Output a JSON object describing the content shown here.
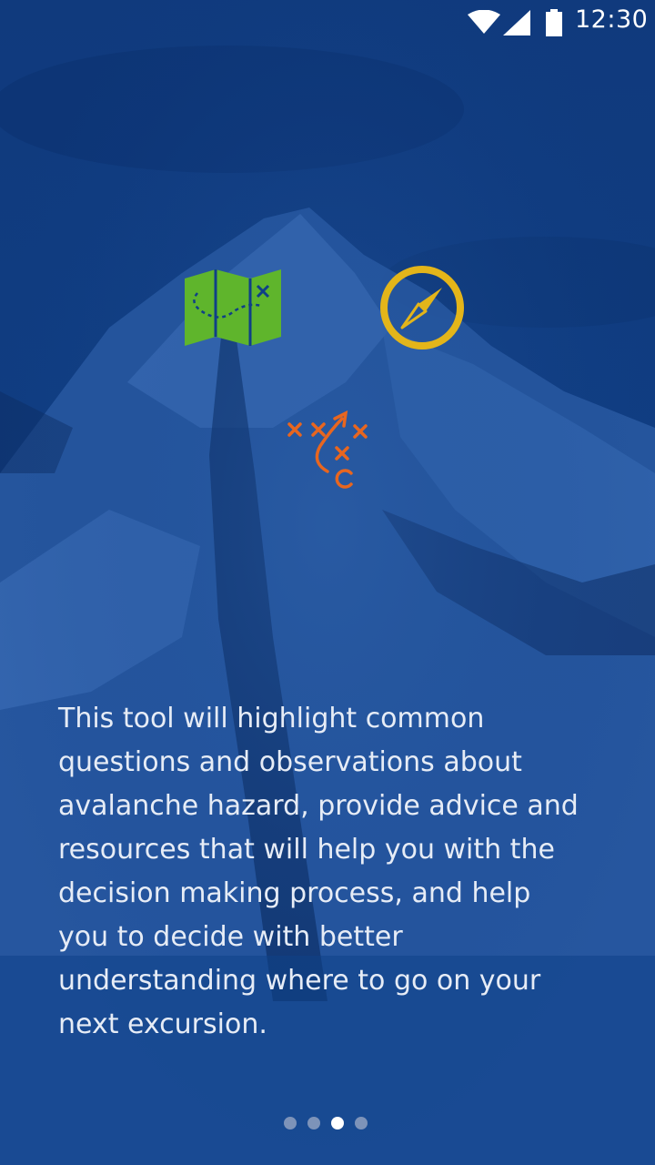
{
  "status_bar": {
    "time": "12:30",
    "icons": [
      "wifi-icon",
      "cellular-signal-icon",
      "battery-icon"
    ]
  },
  "onboarding": {
    "illustrations": [
      "map-icon",
      "compass-icon",
      "strategy-play-icon"
    ],
    "body_text": "This tool will highlight common questions and observations about avalanche hazard, provide advice and resources that will help you with the decision making process, and help you to decide with better understanding where to go on your next excursion.",
    "pager": {
      "total_pages": 4,
      "current_page": 3
    }
  },
  "colors": {
    "background": "#0f3f87",
    "map_green": "#5fb52c",
    "compass_yellow": "#e3b51a",
    "play_orange": "#e8661f",
    "text": "#e6ecf6",
    "dot_inactive": "#7d93b9",
    "dot_active": "#ffffff"
  }
}
